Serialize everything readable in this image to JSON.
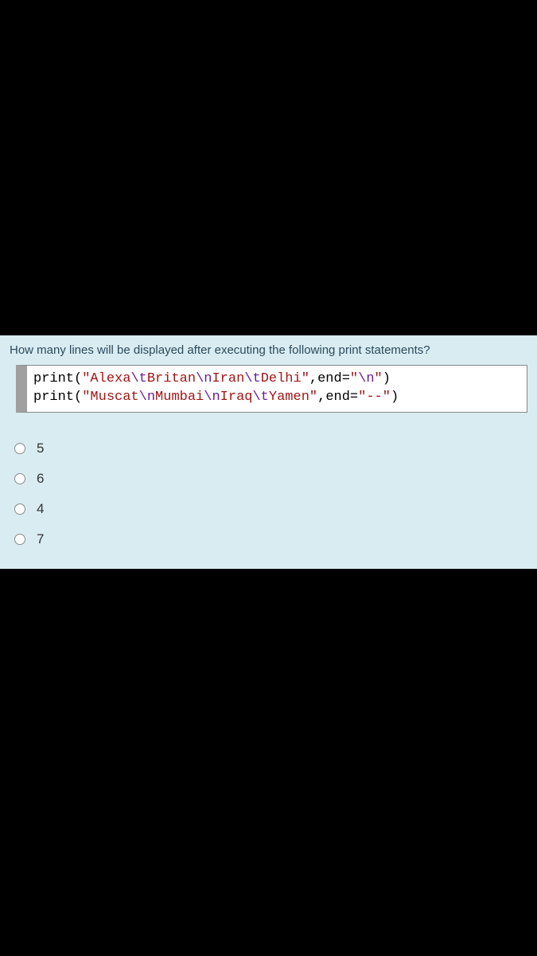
{
  "question": {
    "prompt": "How many lines will be displayed after executing the following print statements?",
    "code": {
      "line1": {
        "func": "print",
        "open": "(",
        "str_open1": "\"",
        "s1": "Alexa",
        "e1": "\\t",
        "s2": "Britan",
        "e2": "\\n",
        "s3": "Iran",
        "e3": "\\t",
        "s4": "Delhi",
        "str_close1": "\"",
        "comma": ",",
        "kw": "end",
        "eq": "=",
        "str_open2": "\"",
        "e4": "\\n",
        "str_close2": "\"",
        "close": ")"
      },
      "line2": {
        "func": "print",
        "open": "(",
        "str_open1": "\"",
        "s1": "Muscat",
        "e1": "\\n",
        "s2": "Mumbai",
        "e2": "\\n",
        "s3": "Iraq",
        "e3": "\\t",
        "s4": "Yamen",
        "str_close1": "\"",
        "comma": ",",
        "kw": "end",
        "eq": "=",
        "str_open2": "\"",
        "s5": "--",
        "str_close2": "\"",
        "close": ")"
      }
    },
    "options": [
      "5",
      "6",
      "4",
      "7"
    ]
  }
}
